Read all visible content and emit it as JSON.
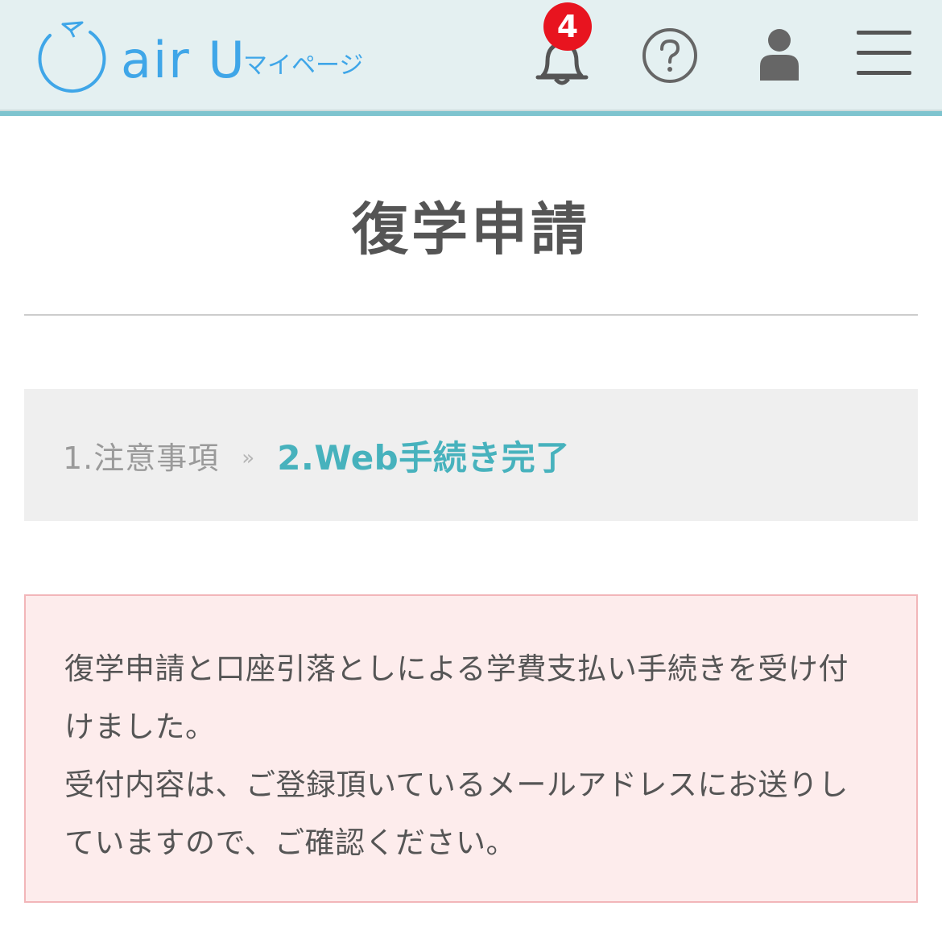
{
  "header": {
    "logo_text": "air U",
    "logo_sub": "マイページ",
    "notification_count": "4",
    "icons": [
      "bell-icon",
      "help-icon",
      "user-icon",
      "menu-icon"
    ],
    "accent_color": "#7ec4cf",
    "logo_color": "#3fa6e8",
    "badge_color": "#e8141f"
  },
  "page": {
    "title": "復学申請"
  },
  "steps": {
    "step1": "1.注意事項",
    "separator": "»",
    "step2": "2.Web手続き完了",
    "active_color": "#47b2bd"
  },
  "notice": {
    "line1": "復学申請と口座引落としによる学費支払い手続きを受け付けました。",
    "line2": "受付内容は、ご登録頂いているメールアドレスにお送りしていますので、ご確認ください。",
    "background": "#fdecec",
    "border_color": "#f2b6b9"
  }
}
